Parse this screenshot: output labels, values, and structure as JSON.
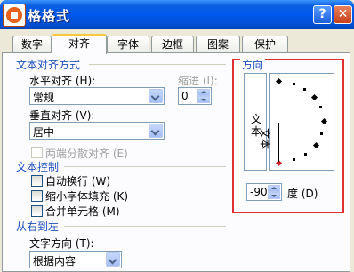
{
  "window": {
    "title": "单元格格式",
    "title_visible": "格格式",
    "help_glyph": "?",
    "close_glyph": "✕"
  },
  "tabs": [
    {
      "label": "数字"
    },
    {
      "label": "对齐"
    },
    {
      "label": "字体"
    },
    {
      "label": "边框"
    },
    {
      "label": "图案"
    },
    {
      "label": "保护"
    }
  ],
  "active_tab": "对齐",
  "text_alignment": {
    "group_title": "文本对齐方式",
    "horizontal_label": "水平对齐 (H):",
    "horizontal_value": "常规",
    "indent_label": "缩进 (I):",
    "indent_value": "0",
    "vertical_label": "垂直对齐 (V):",
    "vertical_value": "居中",
    "distributed_label": "两端分散对齐 (E)"
  },
  "text_control": {
    "group_title": "文本控制",
    "wrap_label": "自动换行 (W)",
    "shrink_label": "缩小字体填充 (K)",
    "merge_label": "合并单元格 (M)"
  },
  "rtl": {
    "group_title": "从右到左",
    "direction_label": "文字方向 (T):",
    "direction_value": "根据内容"
  },
  "orientation": {
    "group_title": "方向",
    "vertical_text": "文本",
    "rotated_text": "文本",
    "degrees_value": "-90",
    "degrees_label": "度 (D)"
  },
  "colors": {
    "highlight_frame": "#e03030",
    "group_title": "#1c4dbe",
    "active_tab_accent": "#ffc83c"
  }
}
